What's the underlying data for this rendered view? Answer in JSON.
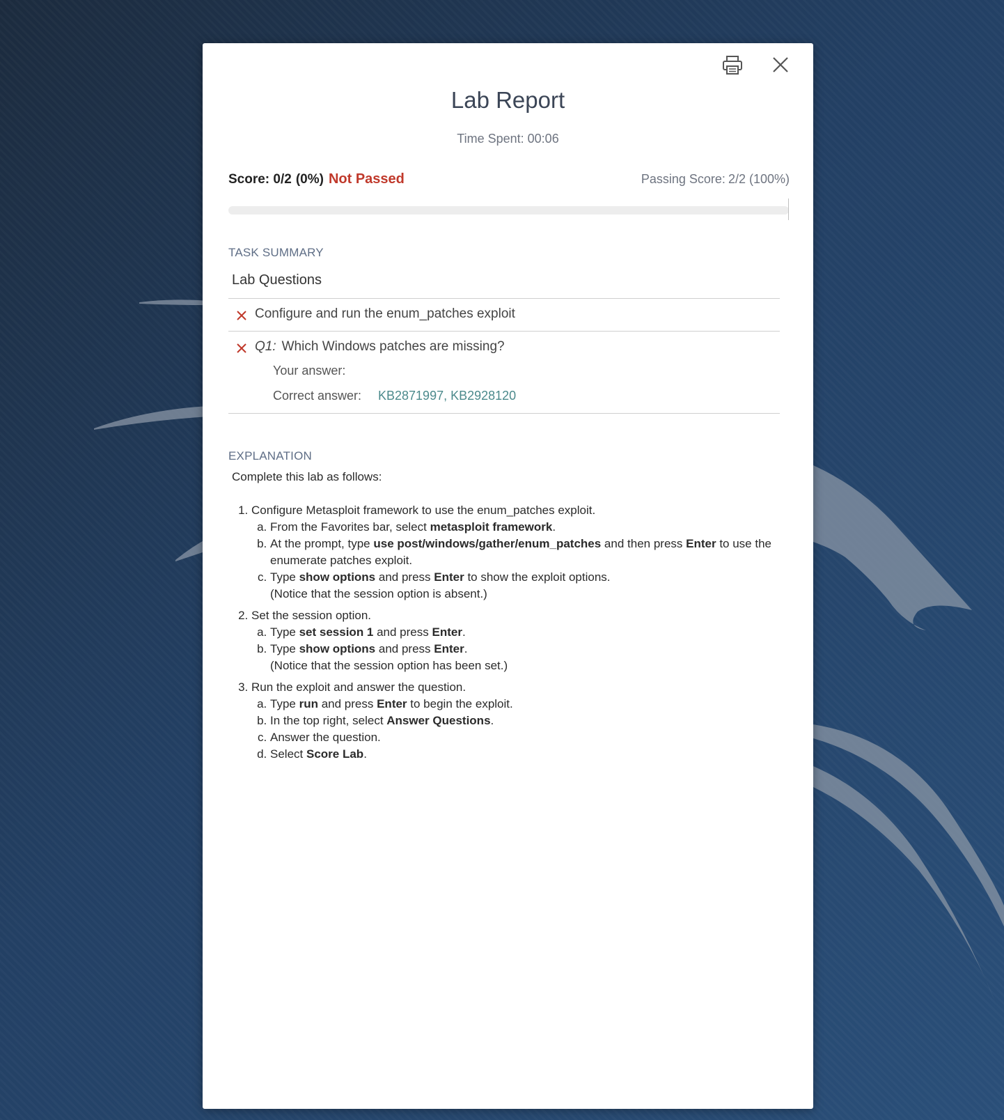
{
  "report": {
    "title": "Lab Report",
    "time_label": "Time Spent:",
    "time_value": "00:06",
    "score_label": "Score: 0/2",
    "score_pct": "(0%)",
    "status": "Not Passed",
    "passing_label": "Passing Score:",
    "passing_value": "2/2 (100%)",
    "progress_fraction": 0,
    "status_color": "#c0392b"
  },
  "icons": {
    "print": "printer-icon",
    "close": "close-icon",
    "fail": "x-mark-icon"
  },
  "task_summary": {
    "heading": "TASK SUMMARY",
    "group_title": "Lab Questions",
    "tasks": [
      {
        "text": "Configure and run the enum_patches exploit",
        "passed": false
      }
    ],
    "question": {
      "label": "Q1:",
      "text": "Which Windows patches are missing?",
      "your_answer_label": "Your answer:",
      "your_answer": "",
      "correct_answer_label": "Correct answer:",
      "correct_answer": "KB2871997, KB2928120",
      "passed": false
    }
  },
  "explanation": {
    "heading": "EXPLANATION",
    "intro": "Complete this lab as follows:",
    "steps": [
      {
        "text": "Configure Metasploit framework to use the enum_patches exploit.",
        "sub": [
          [
            "From the Favorites bar, select ",
            "metasploit framework",
            "."
          ],
          [
            "At the prompt, type ",
            "use post/windows/gather/enum_patches",
            " and then press ",
            "Enter",
            " to use the enumerate patches exploit."
          ],
          [
            "Type ",
            "show options",
            " and press ",
            "Enter",
            " to show the exploit options.",
            "(Notice that the session option is absent.)"
          ]
        ]
      },
      {
        "text": "Set the session option.",
        "sub": [
          [
            "Type ",
            "set session 1",
            " and press ",
            "Enter",
            "."
          ],
          [
            "Type ",
            "show options",
            " and press ",
            "Enter",
            ".",
            "(Notice that the session option has been set.)"
          ]
        ]
      },
      {
        "text": "Run the exploit and answer the question.",
        "sub": [
          [
            "Type ",
            "run",
            " and press ",
            "Enter",
            " to begin the exploit."
          ],
          [
            "In the top right, select ",
            "Answer Questions",
            "."
          ],
          [
            "Answer the question."
          ],
          [
            "Select ",
            "Score Lab",
            "."
          ]
        ]
      }
    ]
  }
}
